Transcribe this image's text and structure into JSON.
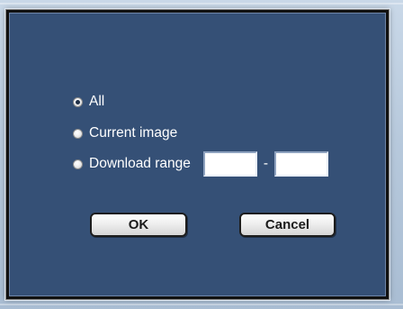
{
  "dialog": {
    "options": [
      {
        "label": "All",
        "selected": true
      },
      {
        "label": "Current image",
        "selected": false
      },
      {
        "label": "Download range",
        "selected": false
      }
    ],
    "range": {
      "from_value": "",
      "to_value": "",
      "separator": "-"
    },
    "ok_label": "OK",
    "cancel_label": "Cancel"
  },
  "colors": {
    "dialog_background": "#355076",
    "text": "#ffffff",
    "button_face": "#eeeeee"
  }
}
